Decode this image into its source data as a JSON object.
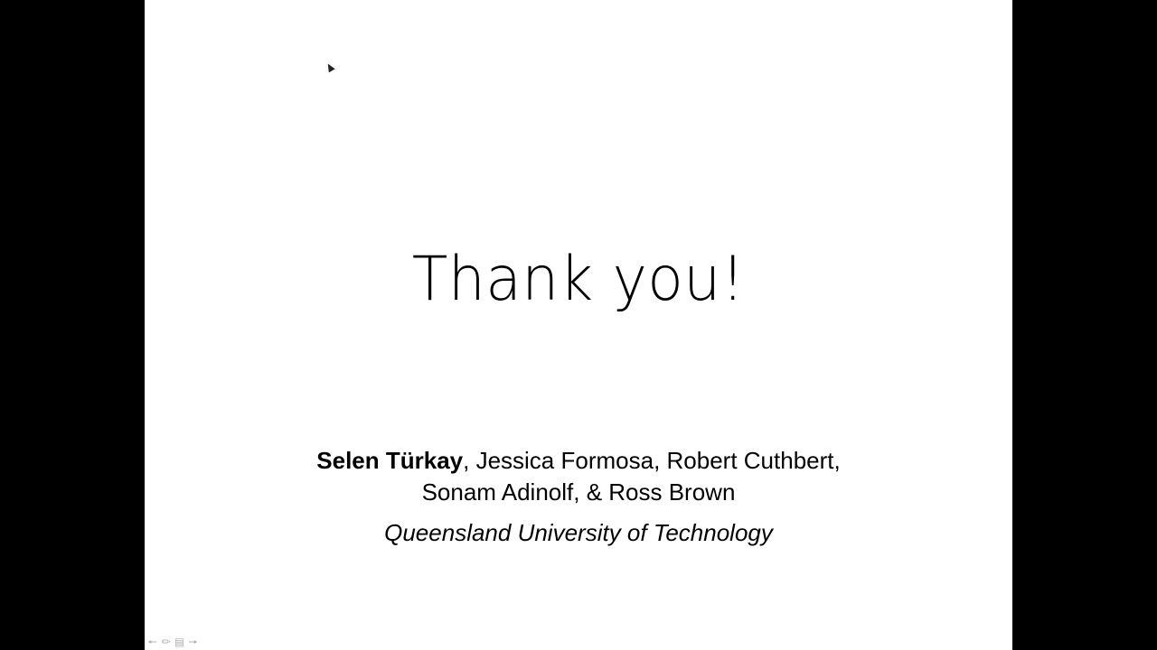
{
  "slide": {
    "title": "Thank you!",
    "lead_author": "Selen Türkay",
    "authors_line1_rest": ", Jessica Formosa, Robert Cuthbert,",
    "authors_line2": "Sonam Adinolf, & Ross Brown",
    "affiliation": "Queensland University of Technology"
  },
  "toolbar": {
    "icons": [
      "previous-slide-icon",
      "pen-icon",
      "slide-menu-icon",
      "next-slide-icon"
    ]
  }
}
